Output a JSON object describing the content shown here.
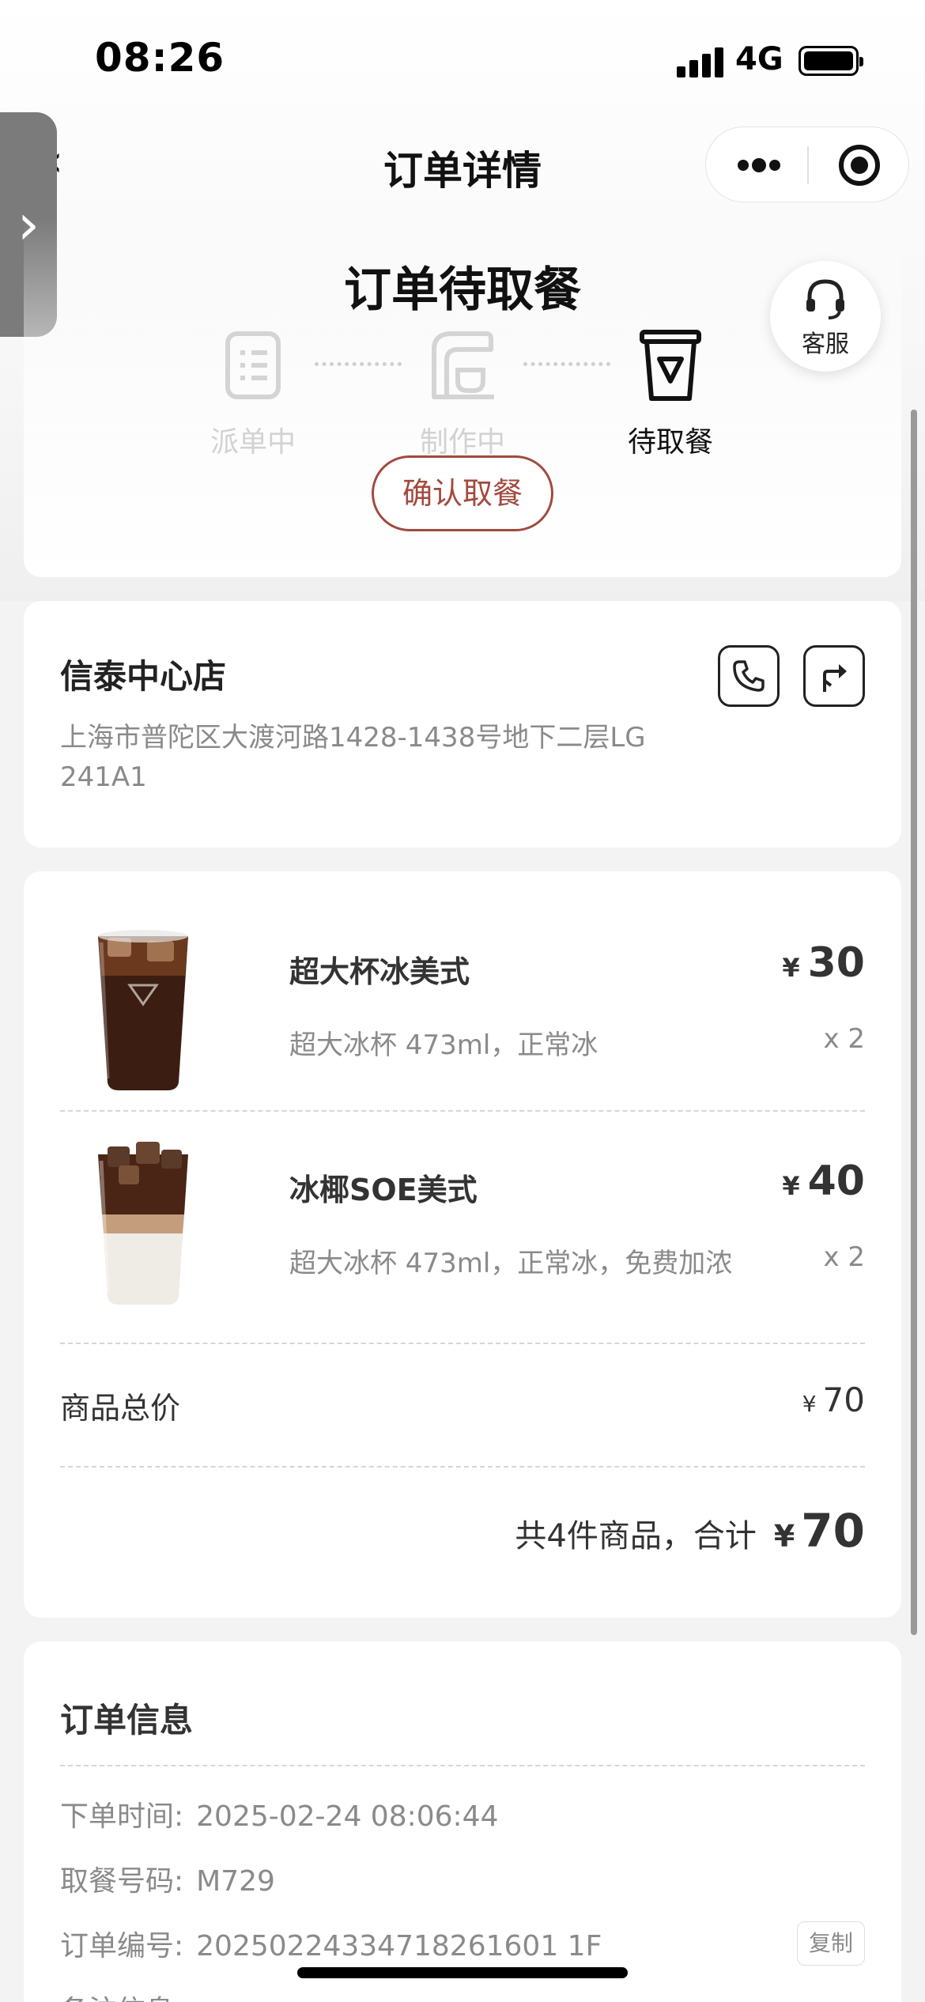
{
  "status_bar": {
    "time": "08:26",
    "network": "4G"
  },
  "nav": {
    "title": "订单详情",
    "back_icon": "chevron-left-icon",
    "more_icon": "more-dots-icon",
    "close_icon": "target-circle-icon"
  },
  "order_status": {
    "title": "订单待取餐",
    "steps": [
      {
        "label": "派单中",
        "icon": "list-icon",
        "state": "done"
      },
      {
        "label": "制作中",
        "icon": "coffee-machine-icon",
        "state": "done"
      },
      {
        "label": "待取餐",
        "icon": "cup-icon",
        "state": "active"
      }
    ],
    "confirm_label": "确认取餐",
    "service_label": "客服"
  },
  "store": {
    "name": "信泰中心店",
    "address": "上海市普陀区大渡河路1428-1438号地下二层LG 241A1"
  },
  "goods": {
    "currency": "¥",
    "items": [
      {
        "name": "超大杯冰美式",
        "spec": "超大冰杯 473ml，正常冰",
        "price": "30",
        "qty": "x 2"
      },
      {
        "name": "冰椰SOE美式",
        "spec": "超大冰杯 473ml，正常冰，免费加浓",
        "price": "40",
        "qty": "x 2"
      }
    ],
    "subtotal_label": "商品总价",
    "subtotal_value": "70",
    "total_text": "共4件商品，合计",
    "total_value": "70"
  },
  "order_info": {
    "title": "订单信息",
    "rows": [
      {
        "label": "下单时间:",
        "value": "2025-02-24 08:06:44"
      },
      {
        "label": "取餐号码:",
        "value": "M729"
      },
      {
        "label": "订单编号:",
        "value": "20250224334718261601 1F"
      },
      {
        "label": "备注信息",
        "value": ""
      }
    ],
    "copy_label": "复制"
  },
  "colors": {
    "accent": "#a24a3f",
    "muted": "#8a8a8a"
  }
}
